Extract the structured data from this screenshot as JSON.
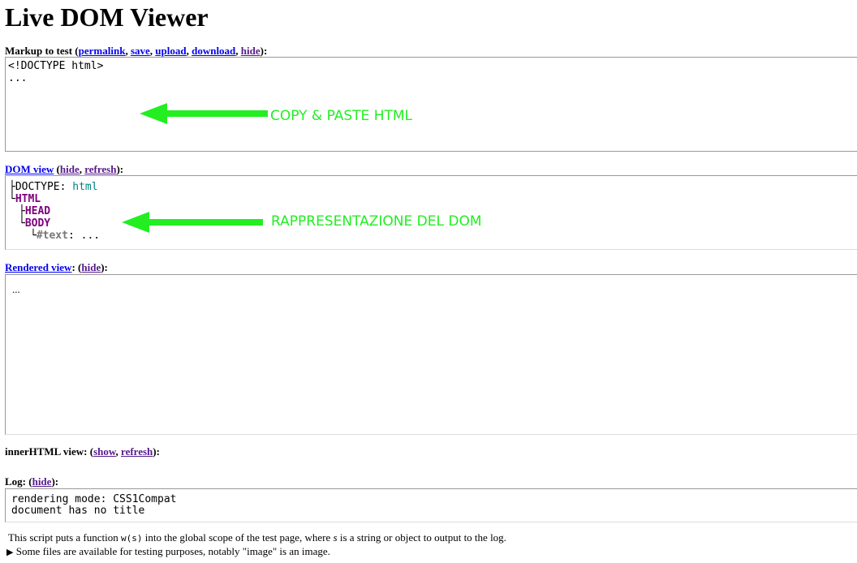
{
  "title": "Live DOM Viewer",
  "markup": {
    "label": "Markup to test",
    "links": [
      "permalink",
      "save",
      "upload",
      "download",
      "hide"
    ],
    "lines": [
      "<!DOCTYPE html>",
      "..."
    ]
  },
  "dom": {
    "label": "DOM view",
    "links": [
      "hide",
      "refresh"
    ],
    "doctype_key": "DOCTYPE",
    "doctype_val": "html",
    "html": "HTML",
    "head": "HEAD",
    "body": "BODY",
    "text_key": "#text",
    "text_val": "..."
  },
  "rendered": {
    "label": "Rendered view",
    "links": [
      "hide"
    ],
    "content": "..."
  },
  "innerhtml": {
    "label": "innerHTML view:",
    "links": [
      "show",
      "refresh"
    ]
  },
  "log": {
    "label": "Log:",
    "links": [
      "hide"
    ],
    "lines": [
      "rendering mode: CSS1Compat",
      "document has no title"
    ]
  },
  "footer": {
    "line1_a": "This script puts a function ",
    "fn": "w(s)",
    "line1_b": " into the global scope of the test page, where ",
    "s": "s",
    "line1_c": " is a string or object to output to the log.",
    "line2": "Some files are available for testing purposes, notably \"image\" is an image."
  },
  "annotations": {
    "a1": "COPY & PASTE HTML",
    "a2": "RAPPRESENTAZIONE DEL DOM",
    "color": "#22ee22"
  }
}
